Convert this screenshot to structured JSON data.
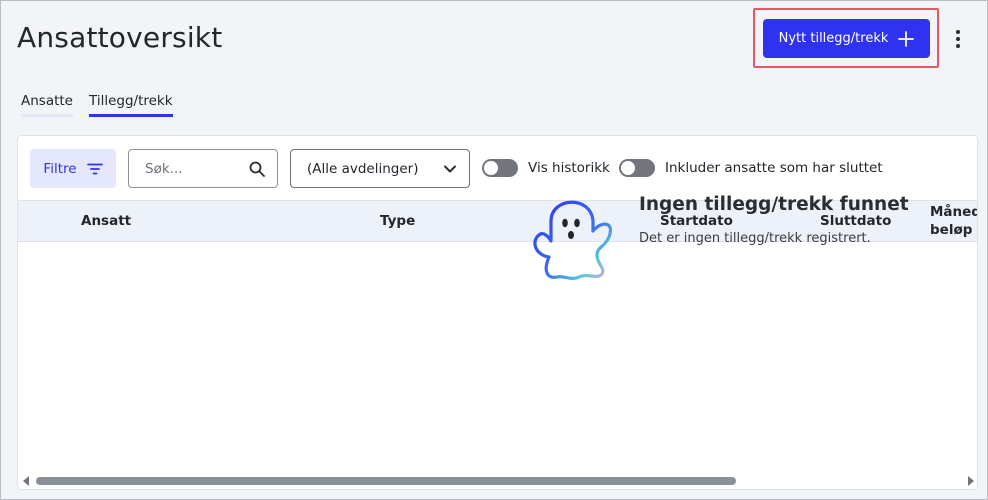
{
  "header": {
    "title": "Ansattoversikt",
    "primary_button_label": "Nytt tillegg/trekk",
    "primary_button_icon": "plus-icon",
    "more_icon": "kebab-menu-icon",
    "accent_color": "#2f33f0",
    "highlight_color": "#e05a63"
  },
  "tabs": [
    {
      "label": "Ansatte",
      "active": false
    },
    {
      "label": "Tillegg/trekk",
      "active": true
    }
  ],
  "toolbar": {
    "filter_label": "Filtre",
    "filter_icon": "filter-lines-icon",
    "search_placeholder": "Søk...",
    "search_value": "",
    "search_icon": "search-icon",
    "department_selected": "(Alle avdelinger)",
    "department_icon": "chevron-down-icon",
    "toggles": [
      {
        "label": "Vis historikk",
        "on": false
      },
      {
        "label": "Inkluder ansatte som har sluttet",
        "on": false
      }
    ]
  },
  "table": {
    "columns": [
      "Ansatt",
      "Type",
      "Startdato",
      "Sluttdato",
      "Månedl",
      "beløp"
    ],
    "rows": []
  },
  "empty_state": {
    "icon": "ghost-icon",
    "title": "Ingen tillegg/trekk funnet",
    "description": "Det er ingen tillegg/trekk registrert."
  }
}
